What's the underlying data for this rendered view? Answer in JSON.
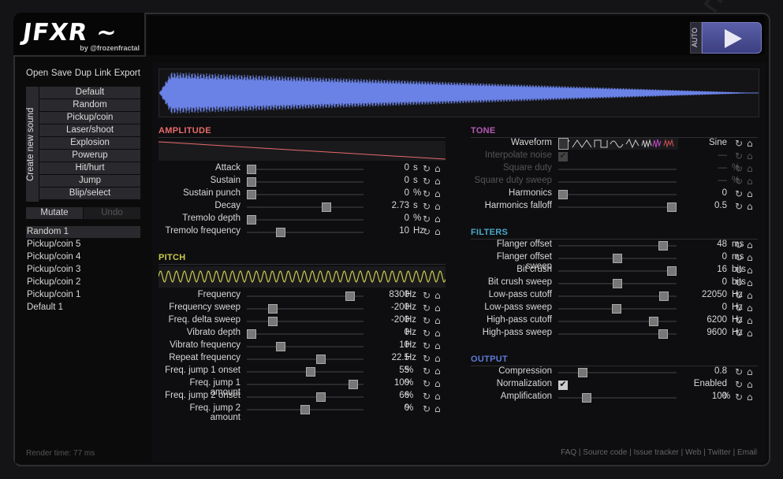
{
  "app": {
    "logo": "JFXR ~",
    "byline": "by @frozenfractal",
    "auto_label": "AUTO",
    "render_time": "Render time: 77 ms"
  },
  "file_menu": [
    "Open",
    "Save",
    "Dup",
    "Link",
    "Export"
  ],
  "generator": {
    "label": "Create new sound",
    "buttons": [
      "Default",
      "Random",
      "Pickup/coin",
      "Laser/shoot",
      "Explosion",
      "Powerup",
      "Hit/hurt",
      "Jump",
      "Blip/select"
    ]
  },
  "mutate_label": "Mutate",
  "undo_label": "Undo",
  "sounds": [
    "Random 1",
    "Pickup/coin 5",
    "Pickup/coin 4",
    "Pickup/coin 3",
    "Pickup/coin 2",
    "Pickup/coin 1",
    "Default 1"
  ],
  "colors": {
    "amplitude": "#e86a6a",
    "pitch": "#c9c94a",
    "tone": "#b45ab4",
    "filters": "#4aa9c9",
    "output": "#5a7ad9",
    "wave": "#6a82e6"
  },
  "amplitude": {
    "title": "AMPLITUDE",
    "rows": [
      {
        "label": "Attack",
        "value": "0",
        "unit": "s",
        "pos": 0
      },
      {
        "label": "Sustain",
        "value": "0",
        "unit": "s",
        "pos": 0
      },
      {
        "label": "Sustain punch",
        "value": "0",
        "unit": "%",
        "pos": 0
      },
      {
        "label": "Decay",
        "value": "2.73",
        "unit": "s",
        "pos": 0.7
      },
      {
        "label": "Tremolo depth",
        "value": "0",
        "unit": "%",
        "pos": 0
      },
      {
        "label": "Tremolo frequency",
        "value": "10",
        "unit": "Hz",
        "pos": 0.27
      }
    ]
  },
  "pitch": {
    "title": "PITCH",
    "rows": [
      {
        "label": "Frequency",
        "value": "8300",
        "unit": "Hz",
        "pos": 0.92
      },
      {
        "label": "Frequency sweep",
        "value": "-200",
        "unit": "Hz",
        "pos": 0.2
      },
      {
        "label": "Freq. delta sweep",
        "value": "-200",
        "unit": "Hz",
        "pos": 0.2
      },
      {
        "label": "Vibrato depth",
        "value": "0",
        "unit": "Hz",
        "pos": 0
      },
      {
        "label": "Vibrato frequency",
        "value": "10",
        "unit": "Hz",
        "pos": 0.27
      },
      {
        "label": "Repeat frequency",
        "value": "22.5",
        "unit": "Hz",
        "pos": 0.65
      },
      {
        "label": "Freq. jump 1 onset",
        "value": "55",
        "unit": "%",
        "pos": 0.55
      },
      {
        "label": "Freq. jump 1 amount",
        "value": "100",
        "unit": "%",
        "pos": 0.95
      },
      {
        "label": "Freq. jump 2 onset",
        "value": "66",
        "unit": "%",
        "pos": 0.65
      },
      {
        "label": "Freq. jump 2 amount",
        "value": "0",
        "unit": "%",
        "pos": 0.5
      }
    ]
  },
  "tone": {
    "title": "TONE",
    "rows": [
      {
        "label": "Waveform",
        "value": "Sine",
        "unit": "",
        "pos": null
      },
      {
        "label": "Interpolate noise",
        "value": "—",
        "unit": "",
        "pos": null,
        "disabled": true,
        "checkbox": true
      },
      {
        "label": "Square duty",
        "value": "—",
        "unit": "%",
        "pos": null,
        "disabled": true
      },
      {
        "label": "Square duty sweep",
        "value": "—",
        "unit": "%",
        "pos": null,
        "disabled": true
      },
      {
        "label": "Harmonics",
        "value": "0",
        "unit": "",
        "pos": 0
      },
      {
        "label": "Harmonics falloff",
        "value": "0.5",
        "unit": "",
        "pos": 1
      }
    ]
  },
  "filters": {
    "title": "FILTERS",
    "rows": [
      {
        "label": "Flanger offset",
        "value": "48",
        "unit": "ms",
        "pos": 0.92
      },
      {
        "label": "Flanger offset sweep",
        "value": "0",
        "unit": "ms",
        "pos": 0.5
      },
      {
        "label": "Bit crush",
        "value": "16",
        "unit": "bits",
        "pos": 1
      },
      {
        "label": "Bit crush sweep",
        "value": "0",
        "unit": "bits",
        "pos": 0.5
      },
      {
        "label": "Low-pass cutoff",
        "value": "22050",
        "unit": "Hz",
        "pos": 0.93
      },
      {
        "label": "Low-pass sweep",
        "value": "0",
        "unit": "Hz",
        "pos": 0.49
      },
      {
        "label": "High-pass cutoff",
        "value": "6200",
        "unit": "Hz",
        "pos": 0.83
      },
      {
        "label": "High-pass sweep",
        "value": "9600",
        "unit": "Hz",
        "pos": 0.92
      }
    ]
  },
  "output": {
    "title": "OUTPUT",
    "rows": [
      {
        "label": "Compression",
        "value": "0.8",
        "unit": "",
        "pos": 0.18
      },
      {
        "label": "Normalization",
        "value": "Enabled",
        "unit": "",
        "pos": null,
        "checkbox": true
      },
      {
        "label": "Amplification",
        "value": "100",
        "unit": "%",
        "pos": 0.22
      }
    ]
  },
  "footer": [
    "FAQ",
    "Source code",
    "Issue tracker",
    "Web",
    "Twitter",
    "Email"
  ]
}
